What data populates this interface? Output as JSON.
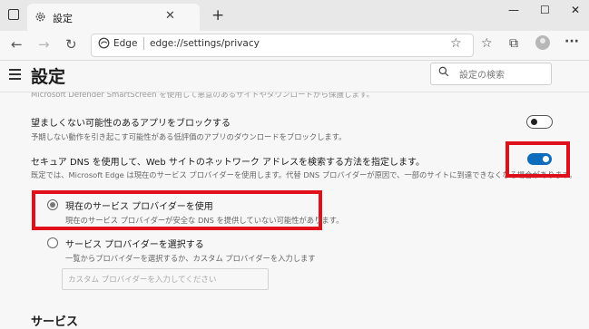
{
  "tab": {
    "title": "設定",
    "close": "✕",
    "new_tab": "+"
  },
  "window": {
    "minimize": "—",
    "maximize": "☐",
    "close": "✕"
  },
  "nav": {
    "back": "←",
    "forward": "→",
    "refresh": "↻"
  },
  "address": {
    "site_label": "Edge",
    "url": "edge://settings/privacy"
  },
  "toolbar": {
    "favorite": "☆",
    "collections": "☆",
    "extensions": "⧉",
    "more": "···"
  },
  "header": {
    "title": "設定",
    "search_placeholder": "設定の検索"
  },
  "content": {
    "cut_text": "Microsoft Defender SmartScreen を使用して悪意のあるサイトやダウンロードから保護します。",
    "pua": {
      "title": "望ましくない可能性のあるアプリをブロックする",
      "desc": "予期しない動作を引き起こす可能性がある低評価のアプリのダウンロードをブロックします。",
      "enabled": false
    },
    "dns": {
      "title": "セキュア DNS を使用して、Web サイトのネットワーク アドレスを検索する方法を指定します。",
      "desc": "既定では、Microsoft Edge は現在のサービス プロバイダーを使用します。代替 DNS プロバイダーが原因で、一部のサイトに到達できなくなる場合があります。",
      "enabled": true
    },
    "option_current": {
      "title": "現在のサービス プロバイダーを使用",
      "desc": "現在のサービス プロバイダーが安全な DNS を提供していない可能性があります。",
      "selected": true
    },
    "option_choose": {
      "title": "サービス プロバイダーを選択する",
      "desc": "一覧からプロバイダーを選択するか、カスタム プロバイダーを入力します",
      "selected": false
    },
    "custom_provider_placeholder": "カスタム プロバイダーを入力してください",
    "next_section": "サービス"
  },
  "colors": {
    "accent": "#0f6cbd",
    "highlight": "#e0101a"
  }
}
